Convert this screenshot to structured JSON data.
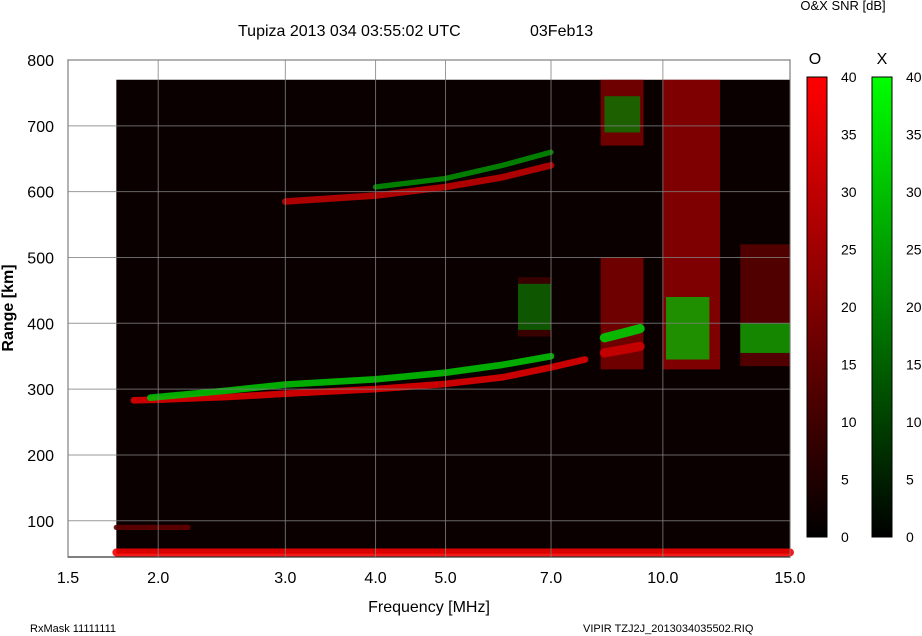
{
  "header": {
    "title": "Tupiza 2013 034 03:55:02 UTC",
    "date": "03Feb13",
    "colorbar_title": "O&X SNR [dB]"
  },
  "footer": {
    "rxmask": "RxMask 11111111",
    "file": "VIPIR  TZJ2J_2013034035502.RIQ"
  },
  "chart_data": {
    "type": "heatmap",
    "xlabel": "Frequency [MHz]",
    "ylabel": "Range [km]",
    "x_scale": "log",
    "xlim": [
      1.5,
      15.0
    ],
    "ylim": [
      45,
      800
    ],
    "grid": true,
    "x_ticks": [
      1.5,
      2.0,
      3.0,
      4.0,
      5.0,
      7.0,
      10.0,
      15.0
    ],
    "x_tick_labels": [
      "1.5",
      "2.0",
      "3.0",
      "4.0",
      "5.0",
      "7.0",
      "10.0",
      "15.0"
    ],
    "y_ticks": [
      100,
      200,
      300,
      400,
      500,
      600,
      700,
      800
    ],
    "y_tick_labels": [
      "100",
      "200",
      "300",
      "400",
      "500",
      "600",
      "700",
      "800"
    ],
    "data_extent": {
      "freq": [
        1.75,
        15.0
      ],
      "range": [
        50,
        770
      ]
    },
    "colorbars": [
      {
        "name": "O",
        "color": "#ff0000",
        "range": [
          0,
          40
        ],
        "ticks": [
          0,
          5,
          10,
          15,
          20,
          25,
          30,
          35,
          40
        ]
      },
      {
        "name": "X",
        "color": "#00ff00",
        "range": [
          0,
          40
        ],
        "ticks": [
          0,
          5,
          10,
          15,
          20,
          25,
          30,
          35,
          40
        ]
      }
    ],
    "traces": [
      {
        "mode": "O",
        "snr": 35,
        "thickness_km": 10,
        "points": [
          [
            1.85,
            283
          ],
          [
            2.0,
            284
          ],
          [
            2.5,
            288
          ],
          [
            3.0,
            293
          ],
          [
            4.0,
            300
          ],
          [
            5.0,
            308
          ],
          [
            6.0,
            318
          ],
          [
            7.0,
            333
          ],
          [
            7.8,
            345
          ]
        ]
      },
      {
        "mode": "X",
        "snr": 30,
        "thickness_km": 10,
        "points": [
          [
            1.95,
            287
          ],
          [
            2.5,
            298
          ],
          [
            3.0,
            307
          ],
          [
            4.0,
            315
          ],
          [
            5.0,
            325
          ],
          [
            6.0,
            337
          ],
          [
            7.0,
            350
          ]
        ]
      },
      {
        "mode": "O",
        "snr": 30,
        "thickness_km": 10,
        "points": [
          [
            3.0,
            585
          ],
          [
            4.0,
            594
          ],
          [
            5.0,
            607
          ],
          [
            6.0,
            622
          ],
          [
            7.0,
            640
          ]
        ]
      },
      {
        "mode": "X",
        "snr": 22,
        "thickness_km": 8,
        "points": [
          [
            4.0,
            607
          ],
          [
            5.0,
            620
          ],
          [
            6.0,
            640
          ],
          [
            7.0,
            660
          ]
        ]
      },
      {
        "mode": "O",
        "snr": 32,
        "thickness_km": 14,
        "points": [
          [
            8.3,
            355
          ],
          [
            8.8,
            360
          ],
          [
            9.3,
            365
          ]
        ]
      },
      {
        "mode": "X",
        "snr": 32,
        "thickness_km": 14,
        "points": [
          [
            8.3,
            378
          ],
          [
            8.8,
            385
          ],
          [
            9.3,
            392
          ]
        ]
      },
      {
        "mode": "O",
        "snr": 38,
        "thickness_km": 12,
        "points": [
          [
            1.75,
            52
          ],
          [
            15.0,
            52
          ]
        ]
      },
      {
        "mode": "O",
        "snr": 15,
        "thickness_km": 8,
        "points": [
          [
            1.75,
            90
          ],
          [
            2.2,
            90
          ]
        ]
      }
    ],
    "patches": [
      {
        "mode": "O",
        "snr": 28,
        "freq": [
          8.2,
          9.4
        ],
        "range": [
          670,
          770
        ]
      },
      {
        "mode": "O",
        "snr": 28,
        "freq": [
          8.2,
          9.4
        ],
        "range": [
          330,
          500
        ]
      },
      {
        "mode": "O",
        "snr": 32,
        "freq": [
          10.0,
          12.0
        ],
        "range": [
          330,
          770
        ]
      },
      {
        "mode": "O",
        "snr": 20,
        "freq": [
          12.8,
          15.0
        ],
        "range": [
          335,
          520
        ]
      },
      {
        "mode": "X",
        "snr": 30,
        "freq": [
          10.1,
          11.6
        ],
        "range": [
          345,
          440
        ]
      },
      {
        "mode": "X",
        "snr": 28,
        "freq": [
          12.8,
          15.0
        ],
        "range": [
          355,
          400
        ]
      },
      {
        "mode": "X",
        "snr": 20,
        "freq": [
          8.3,
          9.3
        ],
        "range": [
          690,
          745
        ]
      },
      {
        "mode": "O",
        "snr": 14,
        "freq": [
          6.3,
          7.0
        ],
        "range": [
          380,
          470
        ]
      },
      {
        "mode": "X",
        "snr": 18,
        "freq": [
          6.3,
          7.0
        ],
        "range": [
          390,
          460
        ]
      }
    ]
  }
}
